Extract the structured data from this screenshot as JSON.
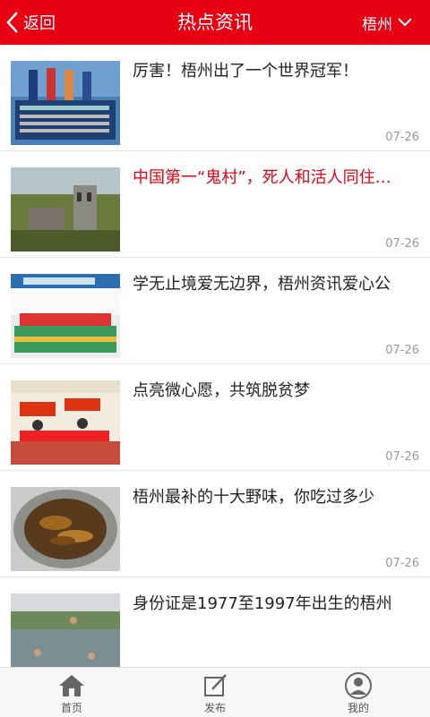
{
  "header": {
    "back_label": "返回",
    "title": "热点资讯",
    "city": "梧州",
    "back_icon": "chevron-left-icon",
    "city_icon": "chevron-down-icon"
  },
  "news": [
    {
      "title": "厉害！梧州出了一个世界冠军！",
      "date": "07-26",
      "highlight": false
    },
    {
      "title": "中国第一“鬼村”，死人和活人同住…",
      "date": "07-26",
      "highlight": true
    },
    {
      "title": "学无止境爱无边界，梧州资讯爱心公",
      "date": "07-26",
      "highlight": false
    },
    {
      "title": "点亮微心愿，共筑脱贫梦",
      "date": "07-26",
      "highlight": false
    },
    {
      "title": "梧州最补的十大野味，你吃过多少",
      "date": "07-26",
      "highlight": false
    },
    {
      "title": "身份证是1977至1997年出生的梧州",
      "date": "",
      "highlight": false
    }
  ],
  "tabs": [
    {
      "label": "首页",
      "icon": "home-icon"
    },
    {
      "label": "发布",
      "icon": "edit-icon"
    },
    {
      "label": "我的",
      "icon": "user-icon"
    }
  ],
  "colors": {
    "brand": "#e60012",
    "highlight_text": "#e60012",
    "date": "#999999"
  }
}
